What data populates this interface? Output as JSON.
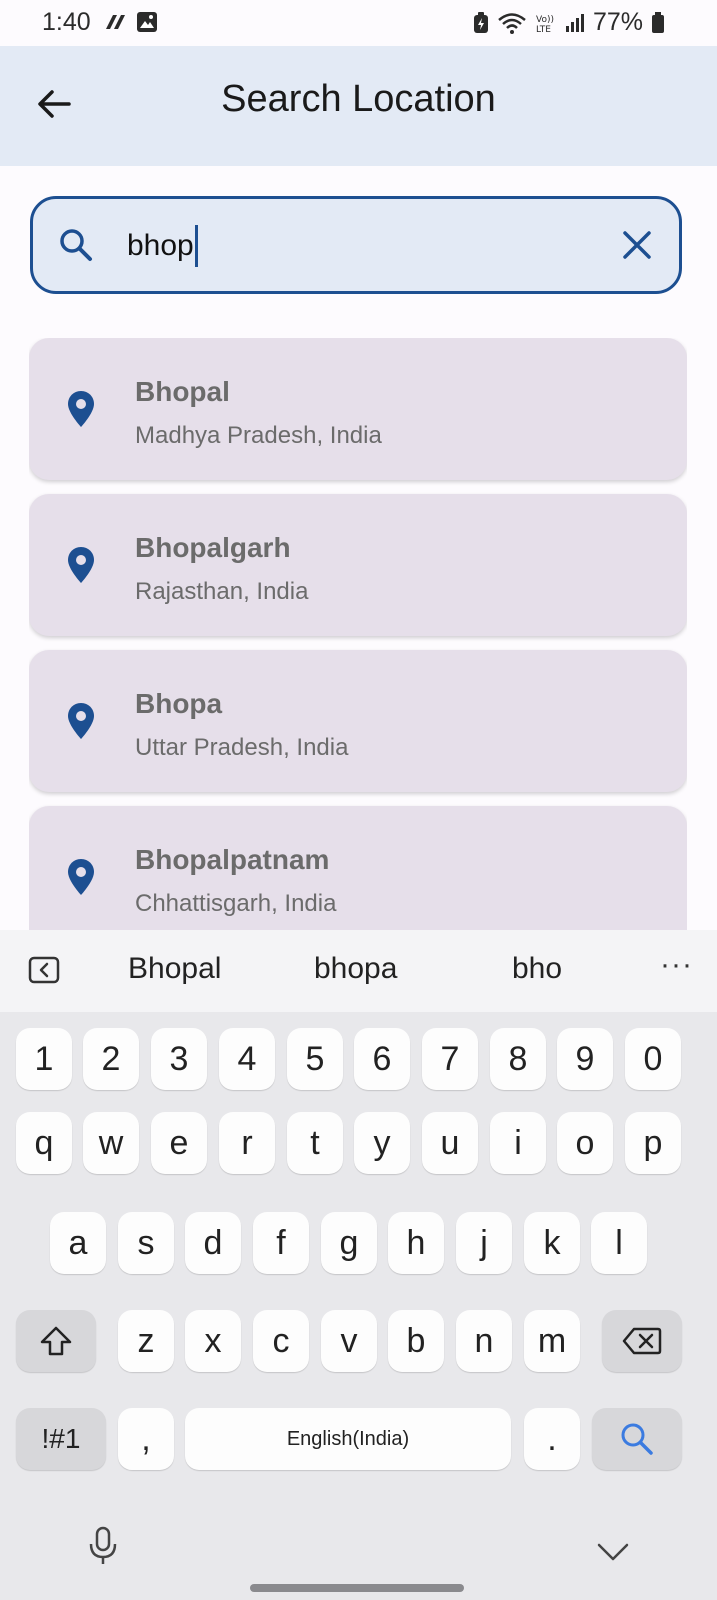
{
  "status_bar": {
    "time": "1:40",
    "battery": "77%"
  },
  "app_bar": {
    "title": "Search Location"
  },
  "search": {
    "value": "bhop"
  },
  "results": [
    {
      "name": "Bhopal",
      "region": "Madhya Pradesh, India"
    },
    {
      "name": "Bhopalgarh",
      "region": "Rajasthan, India"
    },
    {
      "name": "Bhopa",
      "region": "Uttar Pradesh, India"
    },
    {
      "name": "Bhopalpatnam",
      "region": "Chhattisgarh, India"
    }
  ],
  "keyboard": {
    "suggestions": [
      "Bhopal",
      "bhopa",
      "bho"
    ],
    "more": "···",
    "number_row": [
      "1",
      "2",
      "3",
      "4",
      "5",
      "6",
      "7",
      "8",
      "9",
      "0"
    ],
    "row1": [
      "q",
      "w",
      "e",
      "r",
      "t",
      "y",
      "u",
      "i",
      "o",
      "p"
    ],
    "row2": [
      "a",
      "s",
      "d",
      "f",
      "g",
      "h",
      "j",
      "k",
      "l"
    ],
    "row3": [
      "z",
      "x",
      "c",
      "v",
      "b",
      "n",
      "m"
    ],
    "symbols_label": "!#1",
    "comma": ",",
    "space_label": "English(India)",
    "period": "."
  },
  "colors": {
    "accent": "#1d4f91",
    "app_bar_bg": "#e3eaf5",
    "card_bg": "#e6dfea"
  }
}
